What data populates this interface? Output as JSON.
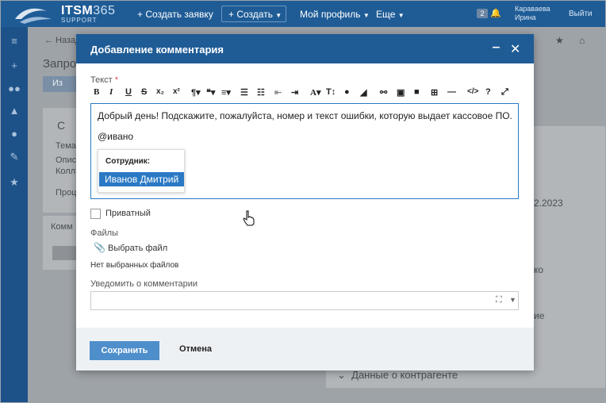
{
  "topbar": {
    "brand": "ITSM",
    "brand_num": "365",
    "brand_sub": "SUPPORT",
    "create_request": "+ Создать заявку",
    "create": "+ Создать",
    "profile": "Мой профиль",
    "more": "Еще",
    "badge_count": "2",
    "user_name_1": "Караваева",
    "user_name_2": "Ирина",
    "logout": "Выйти"
  },
  "background": {
    "back": "← Назад",
    "page_title": "Запро",
    "action": "Из",
    "section": "С",
    "label_theme": "Тема",
    "label_desc": "Опис",
    "value_desc": "Колл",
    "label_proc": "Проц",
    "comments_tab": "Комм",
    "date_fragment": "2.2023",
    "right_fragment_1": "ко",
    "right_fragment_2": "ие",
    "contragent_section": "Данные о контрагенте"
  },
  "modal": {
    "title": "Добавление комментария",
    "text_label": "Текст",
    "required_mark": "*",
    "editor_line1": "Добрый день! Подскажите, пожалуйста, номер и текст ошибки, которую выдает кассовое ПО.",
    "editor_line2": "@ивано",
    "mention_header": "Сотрудник:",
    "mention_option": "Иванов Дмитрий",
    "private_label": "Приватный",
    "files_label": "Файлы",
    "choose_file": "Выбрать файл",
    "no_files": "Нет выбранных файлов",
    "notify_label": "Уведомить о комментарии",
    "save": "Сохранить",
    "cancel": "Отмена"
  },
  "toolbar_icons": [
    "bold-icon",
    "italic-icon",
    "underline-icon",
    "strikethrough-icon",
    "subscript-icon",
    "superscript-icon",
    "paragraph-icon",
    "quote-icon",
    "align-icon",
    "ordered-list-icon",
    "unordered-list-icon",
    "outdent-icon",
    "indent-icon",
    "font-color-icon",
    "font-size-icon",
    "fill-icon",
    "eraser-icon",
    "link-icon",
    "image-icon",
    "video-icon",
    "table-icon",
    "horizontal-rule-icon",
    "code-view-icon",
    "help-icon",
    "fullscreen-icon"
  ],
  "colors": {
    "primary": "#1f5c96",
    "accent": "#2a79c4",
    "save_button": "#4e8fcb"
  }
}
